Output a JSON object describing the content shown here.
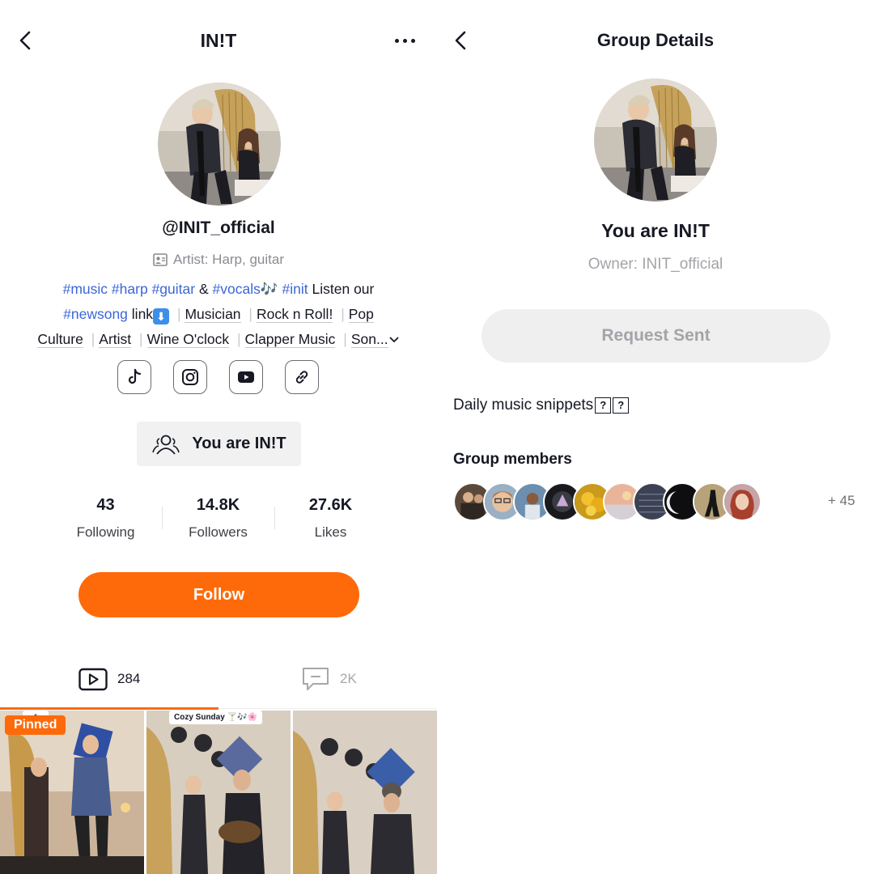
{
  "profile": {
    "title": "IN!T",
    "handle": "@INIT_official",
    "category": "Artist: Harp, guitar",
    "bio": {
      "tag_music": "#music",
      "tag_harp": "#harp",
      "tag_guitar": "#guitar",
      "amp": "&",
      "tag_vocals": "#vocals",
      "notes": "🎶",
      "tag_init": "#init",
      "listen_text": "Listen our",
      "tag_newsong": "#newsong",
      "link_text": "link",
      "link_emoji": "⬇",
      "chips": [
        "Musician",
        "Rock n Roll!",
        "Pop Culture",
        "Artist",
        "Wine O'clock",
        "Clapper Music",
        "Son..."
      ],
      "separator": "|"
    },
    "social_icons": [
      "tiktok-icon",
      "instagram-icon",
      "youtube-icon",
      "link-icon"
    ],
    "group_chip_label": "You are IN!T",
    "stats": [
      {
        "value": "43",
        "label": "Following"
      },
      {
        "value": "14.8K",
        "label": "Followers"
      },
      {
        "value": "27.6K",
        "label": "Likes"
      }
    ],
    "follow_label": "Follow",
    "tabs": {
      "videos_count": "284",
      "comments_count": "2K"
    },
    "thumbnails": {
      "pinned_label": "Pinned",
      "caption_1": "...t...",
      "caption_2": "Cozy Sunday 🍸🎶🌸"
    },
    "colors": {
      "accent": "#fe6a0a",
      "hashtag": "#3b66d9"
    }
  },
  "group": {
    "title": "Group Details",
    "name": "You are IN!T",
    "owner": "Owner: INIT_official",
    "request_label": "Request Sent",
    "description": "Daily music snippets",
    "description_glyphs": [
      "?",
      "?"
    ],
    "members_title": "Group members",
    "members_more": "+ 45"
  }
}
